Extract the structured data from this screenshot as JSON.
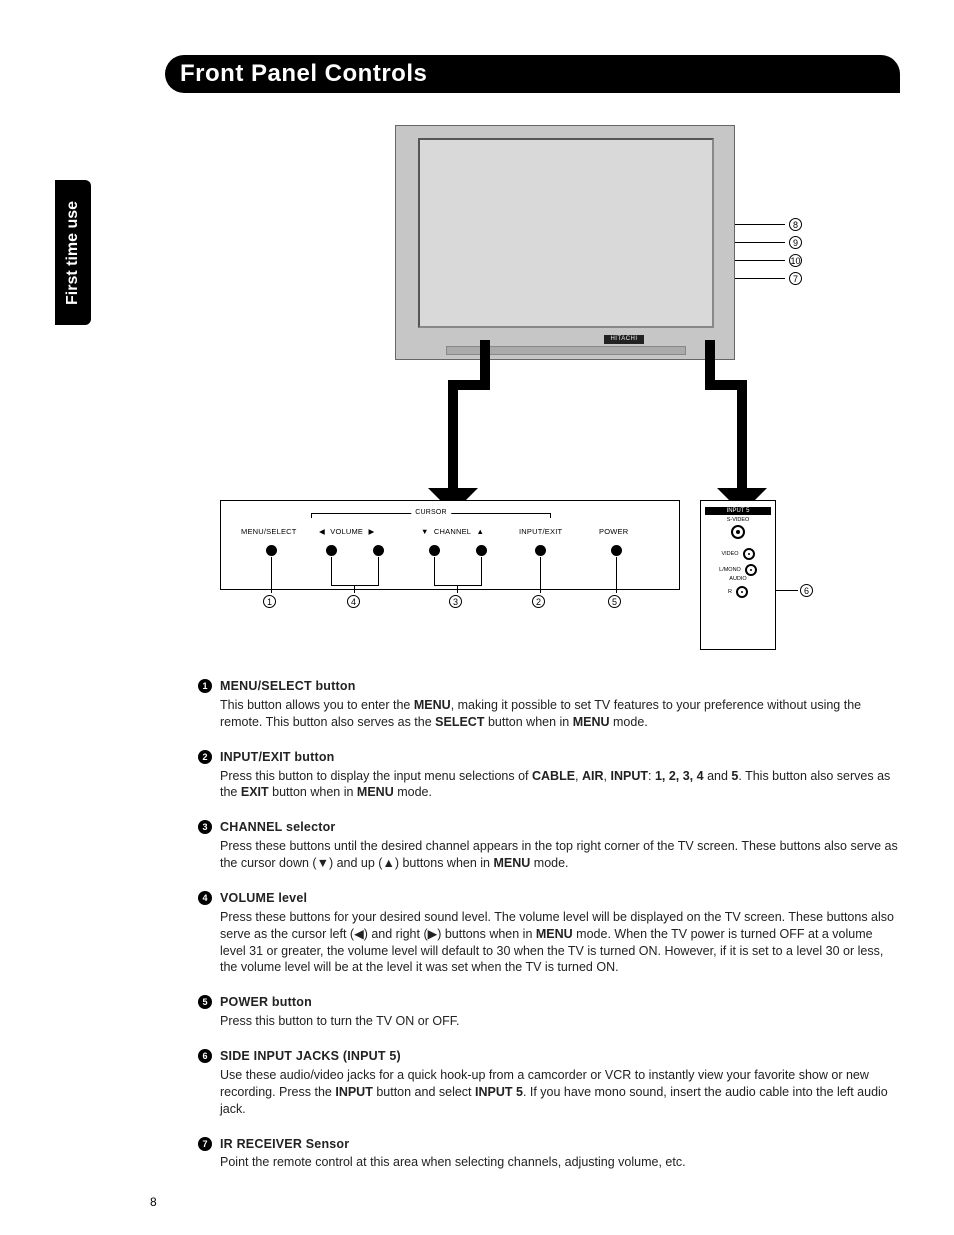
{
  "header": {
    "title": "Front Panel Controls"
  },
  "sideTab": {
    "label": "First time use"
  },
  "pageNumber": "8",
  "tv": {
    "brand": "HITACHI"
  },
  "panel": {
    "cursorLabel": "CURSOR",
    "buttons": {
      "menu": "MENU/SELECT",
      "volume": "VOLUME",
      "channel": "CHANNEL",
      "inputExit": "INPUT/EXIT",
      "power": "POWER"
    },
    "numbering": {
      "menu": "1",
      "volume": "4",
      "channel": "3",
      "inputExit": "2",
      "power": "5"
    }
  },
  "jackPanel": {
    "header": "INPUT 5",
    "svideo": "S-VIDEO",
    "video": "VIDEO",
    "lmono": "L/MONO",
    "audio": "AUDIO",
    "r": "R",
    "number": "6"
  },
  "sideCallouts": {
    "c1": "8",
    "c2": "9",
    "c3": "10",
    "c4": "7"
  },
  "descriptions": [
    {
      "num": "1",
      "title": "MENU/SELECT button",
      "bodyHtml": "This button allows you to enter the <span class='b'>MENU</span>, making it possible to set TV features to your preference without using the remote. This button also serves as the <span class='b'>SELECT</span> button when in <span class='b'>MENU</span> mode."
    },
    {
      "num": "2",
      "title": "INPUT/EXIT button",
      "bodyHtml": "Press this button to display the input menu selections of <span class='b'>CABLE</span>, <span class='b'>AIR</span>, <span class='b'>INPUT</span>: <span class='b'>1, 2, 3, 4</span> and <span class='b'>5</span>. This button also serves as the <span class='b'>EXIT</span> button when in <span class='b'>MENU</span> mode."
    },
    {
      "num": "3",
      "title": "CHANNEL selector",
      "bodyHtml": "Press these buttons until the desired channel appears in the top right corner of the TV screen. These buttons also serve as the cursor down (▼) and up (▲) buttons when in <span class='b'>MENU</span> mode."
    },
    {
      "num": "4",
      "title": "VOLUME level",
      "bodyHtml": "Press these buttons for your desired sound level. The volume level will be displayed on the TV screen. These buttons also serve as the cursor left (◀) and right (▶) buttons when in <span class='b'>MENU</span> mode. When the TV power is turned OFF at a volume level 31 or greater, the volume level will default to 30 when the TV is turned ON. However, if it is set to a level 30 or less, the volume level will be at the level it was set when the TV is turned ON."
    },
    {
      "num": "5",
      "title": "POWER button",
      "bodyHtml": "Press this button to turn the TV ON or OFF."
    },
    {
      "num": "6",
      "title": "SIDE INPUT JACKS (INPUT 5)",
      "bodyHtml": "Use these audio/video jacks for a quick hook-up from a camcorder or VCR to instantly view your favorite show or new recording. Press the <span class='b'>INPUT</span> button and select <span class='b'>INPUT 5</span>. If you have mono sound, insert the audio cable into the left audio jack."
    },
    {
      "num": "7",
      "title": "IR RECEIVER Sensor",
      "bodyHtml": "Point the remote control at this area when selecting channels, adjusting volume, etc."
    }
  ],
  "glyphs": {
    "triLeft": "◀",
    "triRight": "▶",
    "triUp": "▲",
    "triDown": "▼"
  }
}
